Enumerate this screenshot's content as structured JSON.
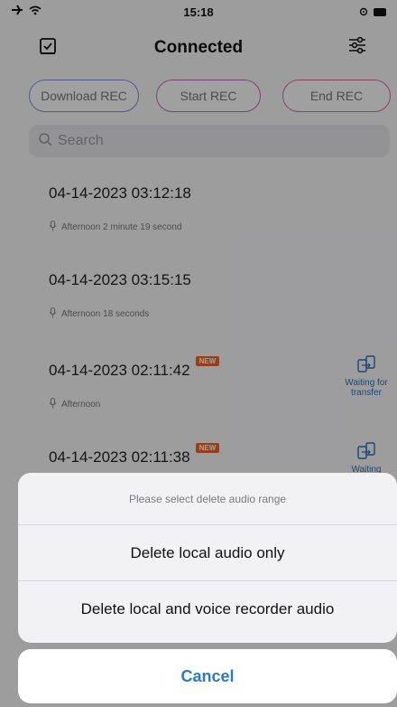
{
  "status_bar": {
    "time": "15:18"
  },
  "header": {
    "title": "Connected"
  },
  "actions": {
    "download_label": "Download REC",
    "start_label": "Start REC",
    "end_label": "End REC"
  },
  "search": {
    "placeholder": "Search"
  },
  "recordings": [
    {
      "date": "04-14-2023 03:12:18",
      "subtitle": "Afternoon 2 minute 19 second",
      "is_new": false
    },
    {
      "date": "04-14-2023 03:15:15",
      "subtitle": "Afternoon 18 seconds",
      "is_new": false
    },
    {
      "date": "04-14-2023 02:11:42",
      "subtitle": "Afternoon",
      "is_new": true,
      "badge": "NEW",
      "transfer_status": "Waiting for transfer"
    },
    {
      "date": "04-14-2023 02:11:38",
      "subtitle": "",
      "is_new": true,
      "badge": "NEW",
      "transfer_status": "Waiting"
    }
  ],
  "action_sheet": {
    "title": "Please select delete audio range",
    "option_local": "Delete local audio only",
    "option_both": "Delete local and voice recorder audio",
    "cancel": "Cancel"
  },
  "colors": {
    "accent_blue": "#2c7ac9",
    "badge_orange": "#e8662b",
    "pill_purple": "#8a7dd6",
    "pill_pink": "#d36ba7"
  }
}
